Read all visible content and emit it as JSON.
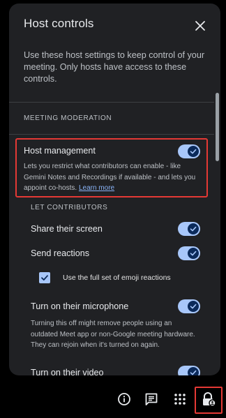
{
  "panel": {
    "title": "Host controls",
    "description": "Use these host settings to keep control of your meeting. Only hosts have access to these controls."
  },
  "moderation": {
    "section_label": "MEETING MODERATION",
    "host_management": {
      "label": "Host management",
      "description": "Lets you restrict what contributors can enable - like Gemini Notes and Recordings if available - and lets you appoint co-hosts.",
      "link": "Learn more",
      "enabled": true
    }
  },
  "contributors": {
    "section_label": "LET CONTRIBUTORS",
    "share_screen": {
      "label": "Share their screen",
      "enabled": true
    },
    "send_reactions": {
      "label": "Send reactions",
      "enabled": true
    },
    "emoji_reactions": {
      "label": "Use the full set of emoji reactions",
      "checked": true
    },
    "microphone": {
      "label": "Turn on their microphone",
      "description": "Turning this off might remove people using an outdated Meet app or non-Google meeting hardware. They can rejoin when it's turned on again.",
      "enabled": true
    },
    "video": {
      "label": "Turn on their video",
      "enabled": true
    }
  },
  "colors": {
    "panel_bg": "#202124",
    "toggle_on": "#a8c7fa",
    "highlight": "#e53935",
    "link": "#8ab4f8"
  },
  "bottom_bar": {
    "icons": [
      "info-icon",
      "chat-icon",
      "activities-icon",
      "host-controls-icon"
    ]
  }
}
